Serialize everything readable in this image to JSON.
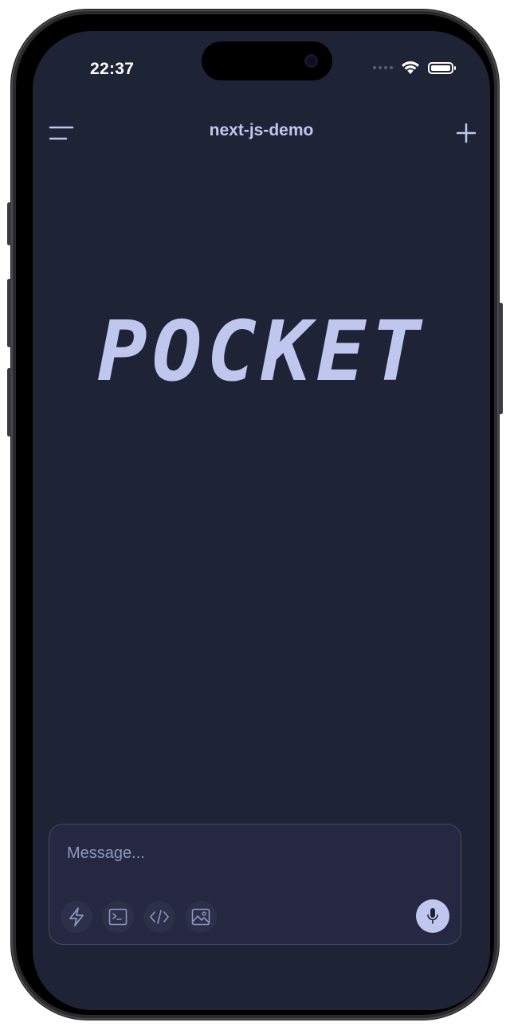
{
  "status_bar": {
    "time": "22:37",
    "icons": [
      "cellular-signal-icon",
      "wifi-icon",
      "battery-icon"
    ]
  },
  "header": {
    "title": "next-js-demo",
    "menu_icon": "menu-icon",
    "new_icon": "plus-icon"
  },
  "hero": {
    "logo_text": "POCKET"
  },
  "composer": {
    "placeholder": "Message...",
    "value": "",
    "tools": [
      "lightning-icon",
      "terminal-icon",
      "code-icon",
      "image-icon"
    ],
    "mic_icon": "microphone-icon"
  },
  "colors": {
    "background": "#1f2336",
    "accent": "#c0c7ef",
    "composer_bg": "#252840",
    "composer_border": "#454b68"
  }
}
